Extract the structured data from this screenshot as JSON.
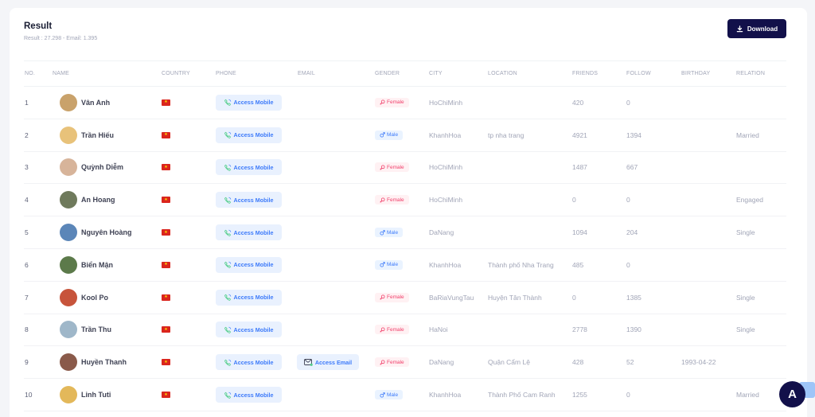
{
  "header": {
    "title": "Result",
    "subtitle": "Result : 27.298 - Email: 1.395",
    "download_label": "Download"
  },
  "columns": [
    "No.",
    "Name",
    "Country",
    "Phone",
    "Email",
    "Gender",
    "City",
    "Location",
    "Friends",
    "Follow",
    "Birthday",
    "Relation"
  ],
  "rows": [
    {
      "no": "1",
      "name": "Vân Anh",
      "avatar_color": "#c9a26b",
      "phone": "Access Mobile",
      "email": "",
      "gender": "Female",
      "city": "HoChiMinh",
      "location": "",
      "friends": "420",
      "follow": "0",
      "birthday": "",
      "relation": ""
    },
    {
      "no": "2",
      "name": "Trần Hiếu",
      "avatar_color": "#e8c27a",
      "phone": "Access Mobile",
      "email": "",
      "gender": "Male",
      "city": "KhanhHoa",
      "location": "tp nha trang",
      "friends": "4921",
      "follow": "1394",
      "birthday": "",
      "relation": "Married"
    },
    {
      "no": "3",
      "name": "Quỳnh Diễm",
      "avatar_color": "#d7b49a",
      "phone": "Access Mobile",
      "email": "",
      "gender": "Female",
      "city": "HoChiMinh",
      "location": "",
      "friends": "1487",
      "follow": "667",
      "birthday": "",
      "relation": ""
    },
    {
      "no": "4",
      "name": "An Hoang",
      "avatar_color": "#6f7a5c",
      "phone": "Access Mobile",
      "email": "",
      "gender": "Female",
      "city": "HoChiMinh",
      "location": "",
      "friends": "0",
      "follow": "0",
      "birthday": "",
      "relation": "Engaged"
    },
    {
      "no": "5",
      "name": "Nguyên Hoàng",
      "avatar_color": "#5b86b8",
      "phone": "Access Mobile",
      "email": "",
      "gender": "Male",
      "city": "DaNang",
      "location": "",
      "friends": "1094",
      "follow": "204",
      "birthday": "",
      "relation": "Single"
    },
    {
      "no": "6",
      "name": "Biển Mận",
      "avatar_color": "#5c7a4a",
      "phone": "Access Mobile",
      "email": "",
      "gender": "Male",
      "city": "KhanhHoa",
      "location": "Thành phố Nha Trang",
      "friends": "485",
      "follow": "0",
      "birthday": "",
      "relation": ""
    },
    {
      "no": "7",
      "name": "Kool Po",
      "avatar_color": "#c7543b",
      "phone": "Access Mobile",
      "email": "",
      "gender": "Female",
      "city": "BaRiaVungTau",
      "location": "Huyện Tân Thành",
      "friends": "0",
      "follow": "1385",
      "birthday": "",
      "relation": "Single"
    },
    {
      "no": "8",
      "name": "Trần Thu",
      "avatar_color": "#9fb7c9",
      "phone": "Access Mobile",
      "email": "",
      "gender": "Female",
      "city": "HaNoi",
      "location": "",
      "friends": "2778",
      "follow": "1390",
      "birthday": "",
      "relation": "Single"
    },
    {
      "no": "9",
      "name": "Huyền Thanh",
      "avatar_color": "#8a5a4a",
      "phone": "Access Mobile",
      "email": "Access Email",
      "gender": "Female",
      "city": "DaNang",
      "location": "Quận Cẩm Lệ",
      "friends": "428",
      "follow": "52",
      "birthday": "1993-04-22",
      "relation": ""
    },
    {
      "no": "10",
      "name": "Linh Tuti",
      "avatar_color": "#e3b85a",
      "phone": "Access Mobile",
      "email": "",
      "gender": "Male",
      "city": "KhanhHoa",
      "location": "Thành Phố Cam Ranh",
      "friends": "1255",
      "follow": "0",
      "birthday": "",
      "relation": "Married"
    }
  ],
  "fab_label": "A"
}
